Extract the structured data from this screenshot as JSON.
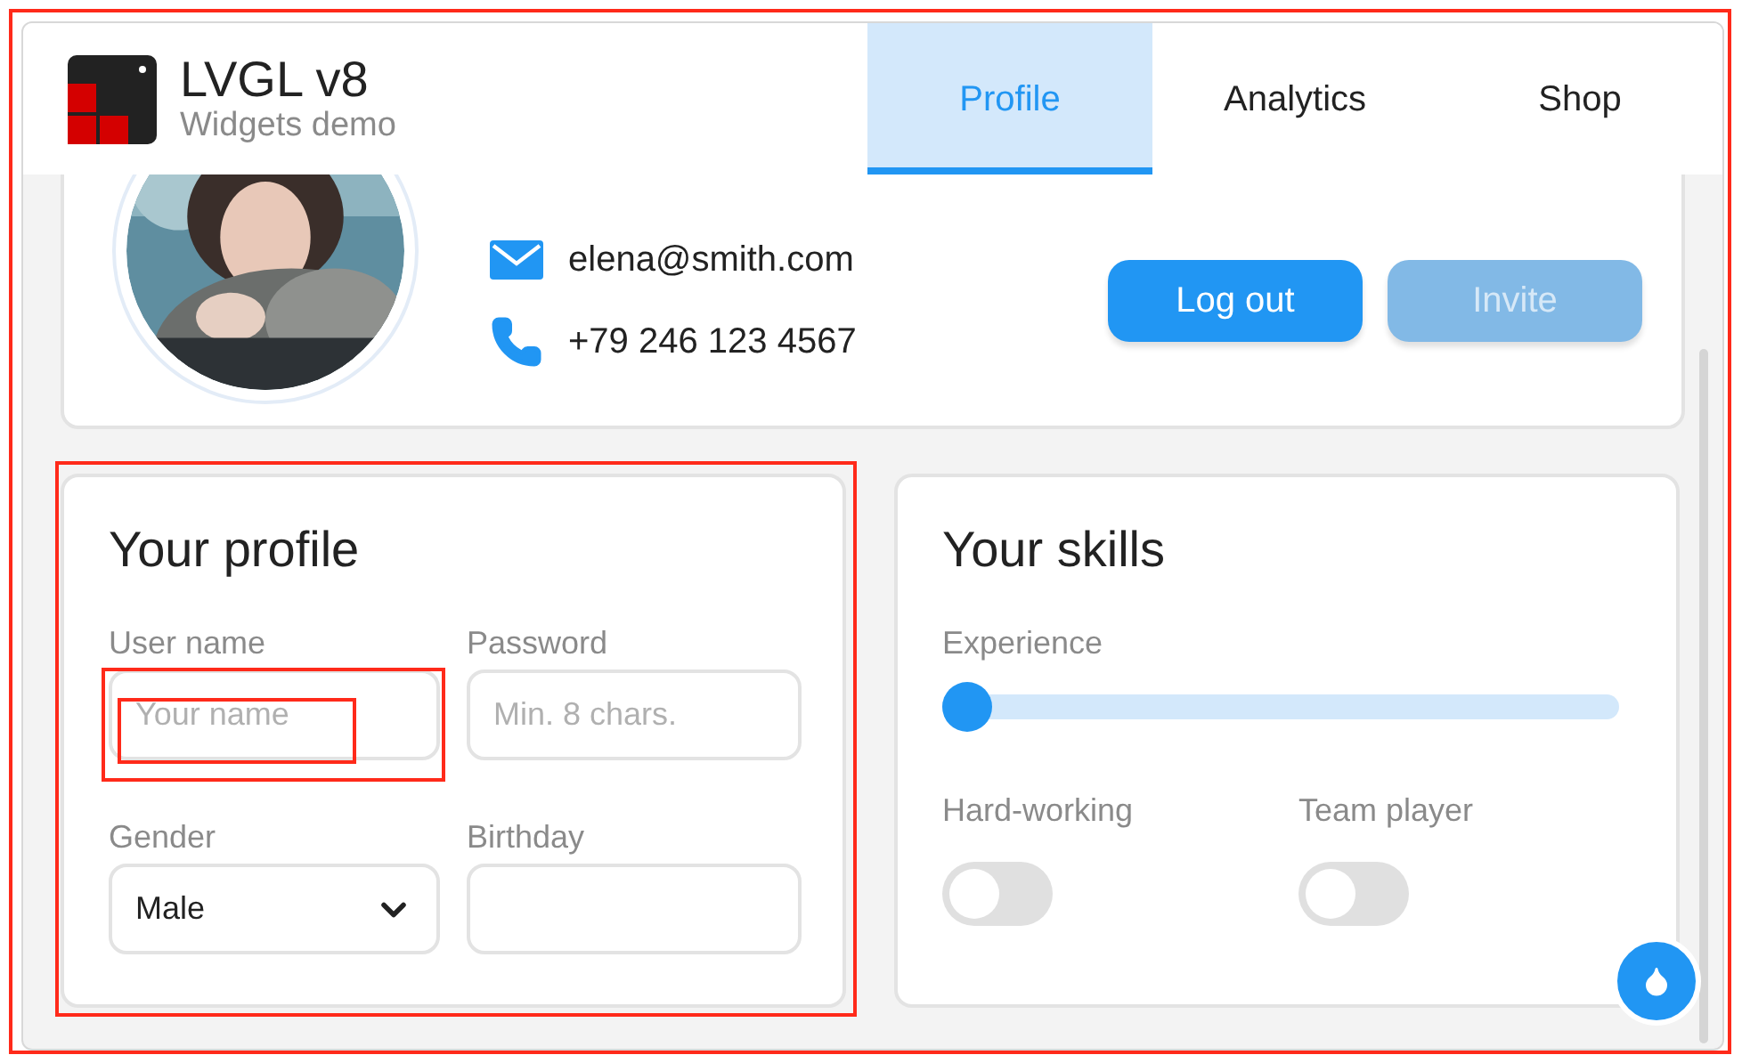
{
  "header": {
    "title": "LVGL v8",
    "subtitle": "Widgets demo"
  },
  "tabs": [
    {
      "label": "Profile",
      "selected": true
    },
    {
      "label": "Analytics",
      "selected": false
    },
    {
      "label": "Shop",
      "selected": false
    }
  ],
  "profile": {
    "email": "elena@smith.com",
    "phone": "+79 246 123 4567",
    "buttons": [
      {
        "label": "Log out",
        "disabled": false
      },
      {
        "label": "Invite",
        "disabled": true
      }
    ]
  },
  "your_profile": {
    "title": "Your profile",
    "fields": [
      {
        "label": "User name",
        "kind": "text",
        "placeholder": "Your name"
      },
      {
        "label": "Password",
        "kind": "text",
        "placeholder": "Min. 8 chars."
      },
      {
        "label": "Gender",
        "kind": "dropdown",
        "value": "Male"
      },
      {
        "label": "Birthday",
        "kind": "text"
      }
    ]
  },
  "your_skills": {
    "title": "Your skills",
    "slider": {
      "label": "Experience",
      "level": 0
    },
    "switches": [
      {
        "label": "Hard-working",
        "on": false
      },
      {
        "label": "Team player",
        "on": false
      }
    ]
  }
}
